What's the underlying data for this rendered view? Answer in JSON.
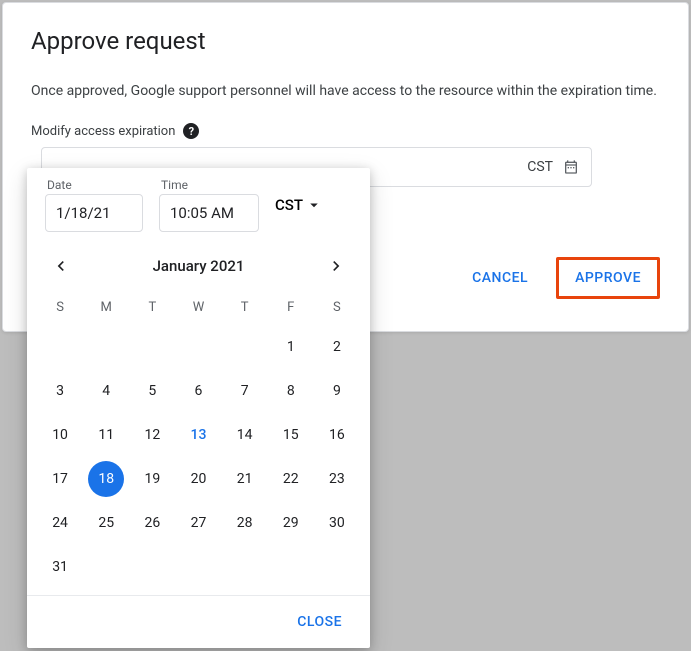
{
  "modal": {
    "title": "Approve request",
    "description": "Once approved, Google support personnel will have access to the resource within the expiration time.",
    "expiration_label": "Modify access expiration",
    "timezone": "CST",
    "cancel_label": "CANCEL",
    "approve_label": "APPROVE"
  },
  "datepicker": {
    "date_label": "Date",
    "date_value": "1/18/21",
    "time_label": "Time",
    "time_value": "10:05 AM",
    "timezone": "CST",
    "month_title": "January 2021",
    "weekdays": [
      "S",
      "M",
      "T",
      "W",
      "T",
      "F",
      "S"
    ],
    "today": 13,
    "selected": 18,
    "first_weekday": 5,
    "days_in_month": 31,
    "close_label": "CLOSE"
  }
}
